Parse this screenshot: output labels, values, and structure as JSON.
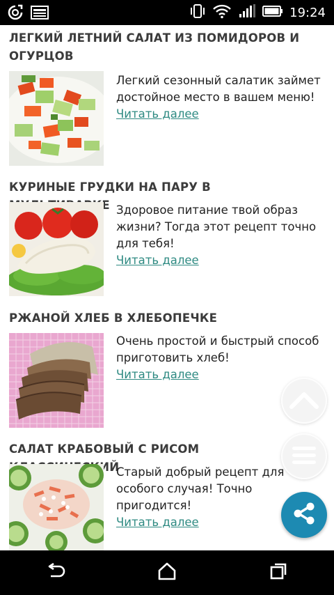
{
  "status_bar": {
    "time": "19:24",
    "left_icons": [
      "sync-icon",
      "notification-card-icon"
    ],
    "right_icons": [
      "vibrate-icon",
      "wifi-icon",
      "signal-icon",
      "battery-icon"
    ]
  },
  "articles": [
    {
      "title": "ЛЕГКИЙ ЛЕТНИЙ САЛАТ ИЗ ПОМИДОРОВ И\nОГУРЦОВ",
      "image": "salad-photo",
      "text": "Легкий сезонный салатик займет достойное место в вашем меню!",
      "link": "Читать далее"
    },
    {
      "title": "КУРИНЫЕ ГРУДКИ НА ПАРУ В МУЛЬТИВАРКЕ",
      "image": "chicken-photo",
      "text": "Здоровое питание твой образ жизни? Тогда этот рецепт точно для тебя!",
      "link": "Читать далее"
    },
    {
      "title": "РЖАНОЙ ХЛЕБ В ХЛЕБОПЕЧКЕ",
      "image": "bread-photo",
      "text": "Очень простой и быстрый способ приготовить хлеб!",
      "link": "Читать далее"
    },
    {
      "title": "САЛАТ КРАБОВЫЙ С РИСОМ КЛАССИЧЕСКИЙ",
      "image": "crab-salad-photo",
      "text": "Старый добрый рецепт для особого случая! Точно пригодится!",
      "link": "Читать далее"
    }
  ],
  "fabs": {
    "scroll_top_icon": "chevron-up-icon",
    "menu_icon": "menu-icon",
    "share_icon": "share-icon",
    "share_color": "#1d8ab2"
  },
  "nav_bar": {
    "icons": [
      "back-icon",
      "home-icon",
      "recents-icon"
    ]
  },
  "colors": {
    "title": "#3b3b3b",
    "link": "#2e8a82",
    "status_bar": "#000000"
  }
}
